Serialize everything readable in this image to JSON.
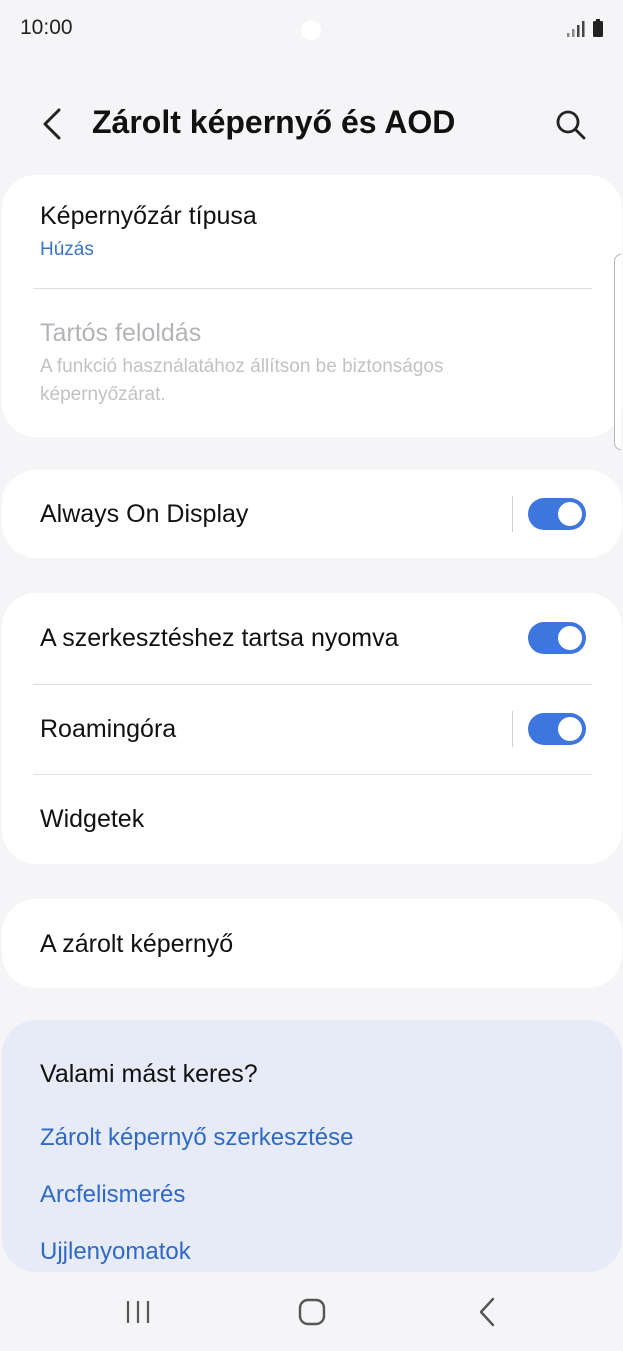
{
  "status_bar": {
    "time": "10:00",
    "icons": [
      "camera-dot",
      "signal-icon",
      "battery-icon"
    ]
  },
  "header": {
    "title": "Zárolt képernyő és AOD",
    "back_icon": "chevron-left-icon",
    "search_icon": "search-icon"
  },
  "lock_section": {
    "screen_lock_type": {
      "title": "Képernyőzár típusa",
      "value": "Húzás"
    },
    "extend_unlock": {
      "title": "Tartós feloldás",
      "subtitle": "A funkció használatához állítson be biztonságos képernyőzárat.",
      "enabled": false
    }
  },
  "aod_section": {
    "always_on_display": {
      "title": "Always On Display",
      "toggle": true
    }
  },
  "edit_section": {
    "hold_to_edit": {
      "title": "A szerkesztéshez tartsa nyomva",
      "toggle": true
    },
    "roaming_clock": {
      "title": "Roamingóra",
      "toggle": true
    },
    "widgets": {
      "title": "Widgetek"
    }
  },
  "about_section": {
    "about_lock_screen": {
      "title": "A zárolt képernyő"
    }
  },
  "suggestions": {
    "heading": "Valami mást keres?",
    "links": [
      "Zárolt képernyő szerkesztése",
      "Arcfelismerés",
      "Ujjlenyomatok"
    ]
  },
  "nav_bar": {
    "icons": [
      "recent-apps-icon",
      "home-icon",
      "back-icon"
    ]
  },
  "colors": {
    "accent": "#3e76e0",
    "link": "#2f69c6",
    "background": "#f5f5f7",
    "card": "#ffffff",
    "suggest_background": "#e7ebf7"
  }
}
